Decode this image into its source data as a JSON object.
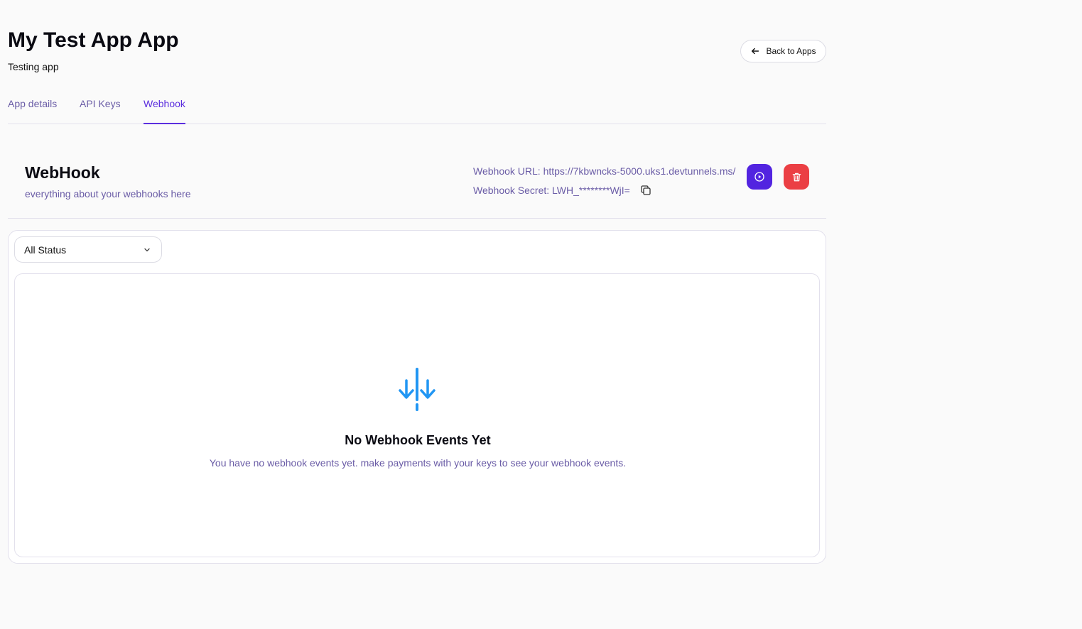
{
  "header": {
    "title": "My Test App App",
    "subtitle": "Testing app",
    "back_label": "Back to Apps"
  },
  "tabs": [
    {
      "label": "App details",
      "active": false
    },
    {
      "label": "API Keys",
      "active": false
    },
    {
      "label": "Webhook",
      "active": true
    }
  ],
  "webhook": {
    "title": "WebHook",
    "description": "everything about your webhooks here",
    "url_line": "Webhook URL: https://7kbwncks-5000.uks1.devtunnels.ms/",
    "secret_line": "Webhook Secret: LWH_********WjI="
  },
  "filter": {
    "selected": "All Status"
  },
  "empty_state": {
    "title": "No Webhook Events Yet",
    "description": "You have no webhook events yet. make payments with your keys to see your webhook events."
  },
  "icons": {
    "back": "arrow-left-icon",
    "copy": "copy-icon",
    "test": "play-circle-icon",
    "delete": "trash-icon",
    "dropdown": "chevron-down-icon",
    "empty": "webhook-arrows-icon"
  },
  "colors": {
    "accent": "#5224e0",
    "danger": "#eb3f44",
    "muted_text": "#6a5ca6",
    "empty_icon": "#2196f3"
  }
}
